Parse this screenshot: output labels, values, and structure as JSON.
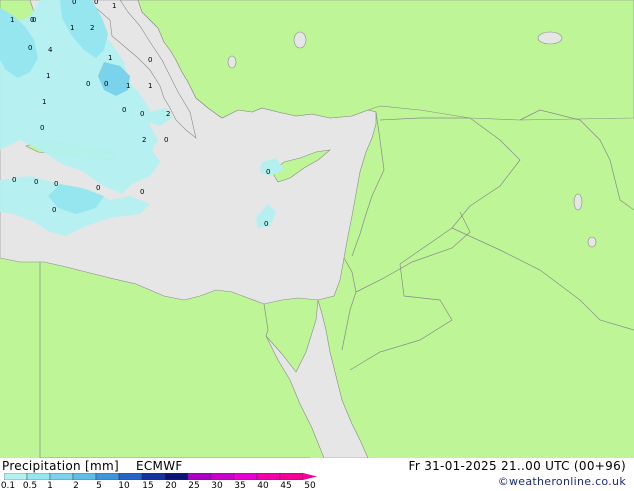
{
  "header": {
    "title": "Precipitation [mm]",
    "model": "ECMWF",
    "valid_time": "Fr 31-01-2025 21..00 UTC (00+96)",
    "credit": "©weatheronline.co.uk"
  },
  "legend": {
    "ticks": [
      "0.1",
      "0.5",
      "1",
      "2",
      "5",
      "10",
      "15",
      "20",
      "25",
      "30",
      "35",
      "40",
      "45",
      "50"
    ],
    "colors": [
      "#b4f0f0",
      "#96e6f0",
      "#7ad2eb",
      "#5fbee6",
      "#3c96dc",
      "#2364c8",
      "#1432a0",
      "#0a1478",
      "#aa00c8",
      "#c800c8",
      "#e600d2",
      "#f000aa",
      "#f50096"
    ]
  },
  "map": {
    "colors": {
      "land": "#bef596",
      "sea": "#e6e6e6",
      "precip_light": "#b4f0f0",
      "precip_medium": "#96e6f0",
      "precip_heavy": "#7ad2eb",
      "border": "#8a8a8a"
    },
    "point_values": [
      "1",
      "0",
      "0",
      "1",
      "2",
      "1",
      "0",
      "4",
      "0",
      "1",
      "1",
      "0",
      "0",
      "1",
      "1",
      "2",
      "0",
      "1",
      "0",
      "2",
      "0",
      "0",
      "0",
      "0",
      "0",
      "0",
      "0",
      "0",
      "0",
      "0",
      "0",
      "0"
    ]
  }
}
